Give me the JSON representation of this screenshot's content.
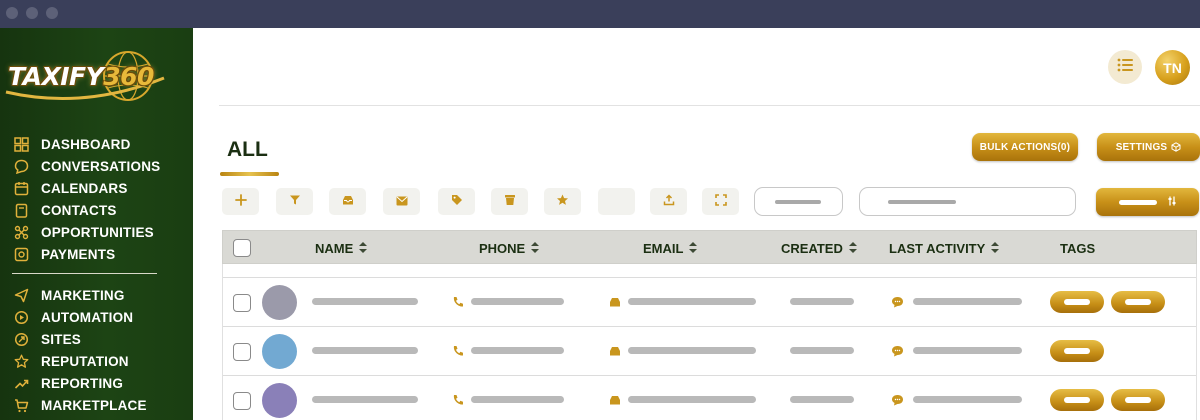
{
  "window": {
    "controls": [
      "close",
      "minimize",
      "maximize"
    ]
  },
  "brand": {
    "logo_text": "TAXIFY",
    "logo_number": "360"
  },
  "sidebar": {
    "items": [
      {
        "label": "DASHBOARD",
        "icon": "grid-icon"
      },
      {
        "label": "CONVERSATIONS",
        "icon": "chat-bubble-icon"
      },
      {
        "label": "CALENDARS",
        "icon": "calendar-icon"
      },
      {
        "label": "CONTACTS",
        "icon": "contact-card-icon"
      },
      {
        "label": "OPPORTUNITIES",
        "icon": "opportunities-icon"
      },
      {
        "label": "PAYMENTS",
        "icon": "payment-icon"
      },
      {
        "label": "MARKETING",
        "icon": "send-icon"
      },
      {
        "label": "AUTOMATION",
        "icon": "automation-icon"
      },
      {
        "label": "SITES",
        "icon": "globe-icon"
      },
      {
        "label": "REPUTATION",
        "icon": "star-icon"
      },
      {
        "label": "REPORTING",
        "icon": "trend-icon"
      },
      {
        "label": "MARKETPLACE",
        "icon": "cart-icon"
      }
    ]
  },
  "header": {
    "avatar_initials": "TN",
    "list_icon": "list-icon"
  },
  "tabs": {
    "active": "ALL"
  },
  "actions": {
    "bulk_label": "BULK ACTIONS(0)",
    "settings_label": "SETTINGS"
  },
  "toolbar": {
    "buttons": [
      "add-icon",
      "filter-icon",
      "inbox-icon",
      "mail-icon",
      "tag-icon",
      "trash-icon",
      "star-icon",
      "blank",
      "upload-icon",
      "expand-icon"
    ]
  },
  "table": {
    "columns": [
      "NAME",
      "PHONE",
      "EMAIL",
      "CREATED",
      "LAST ACTIVITY",
      "TAGS"
    ],
    "rows": [
      {
        "avatar_color": "#9b9aaa",
        "tag_count": 2
      },
      {
        "avatar_color": "#72a9d2",
        "tag_count": 1
      },
      {
        "avatar_color": "#8a80b8",
        "tag_count": 2
      }
    ]
  },
  "colors": {
    "sidebar": "#1d4414",
    "gold": "#c89018",
    "titlebar": "#3a3f5a",
    "header_text": "#1b2f12"
  }
}
